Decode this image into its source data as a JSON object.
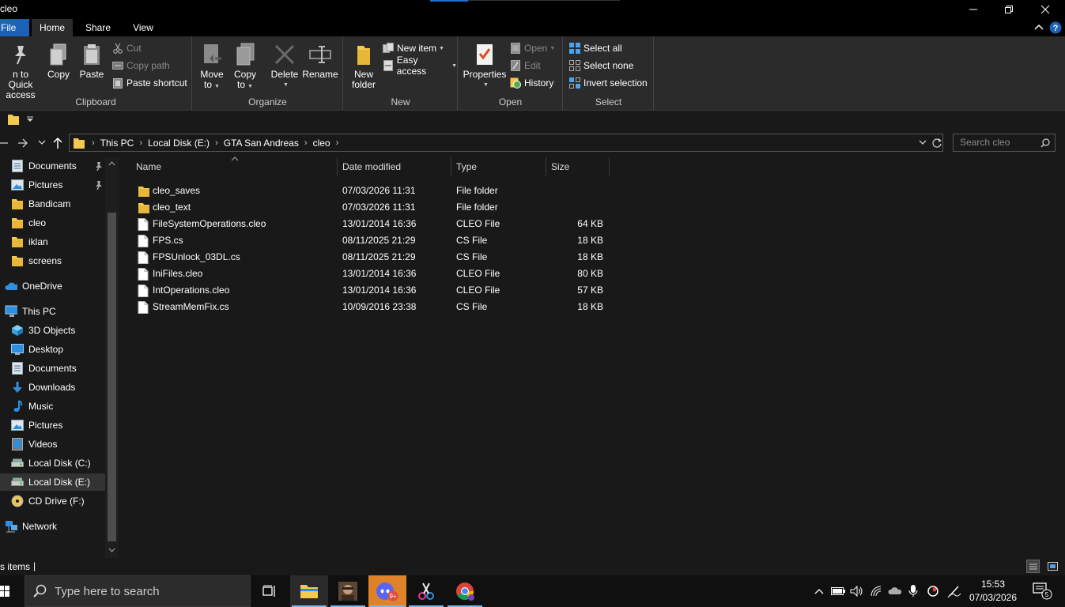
{
  "window": {
    "title": "cleo"
  },
  "ribbon_tabs": [
    "File",
    "Home",
    "Share",
    "View"
  ],
  "ribbon": {
    "clipboard": {
      "label": "Clipboard",
      "pin_label_1": "n to Quick",
      "pin_label_2": "access",
      "copy": "Copy",
      "paste": "Paste",
      "cut": "Cut",
      "copy_path": "Copy path",
      "paste_shortcut": "Paste shortcut"
    },
    "organize": {
      "label": "Organize",
      "move_to_1": "Move",
      "move_to_2": "to",
      "copy_to_1": "Copy",
      "copy_to_2": "to",
      "delete": "Delete",
      "rename": "Rename"
    },
    "new": {
      "label": "New",
      "new_folder_1": "New",
      "new_folder_2": "folder",
      "new_item": "New item",
      "easy_access": "Easy access"
    },
    "open": {
      "label": "Open",
      "properties": "Properties",
      "open": "Open",
      "edit": "Edit",
      "history": "History"
    },
    "select": {
      "label": "Select",
      "select_all": "Select all",
      "select_none": "Select none",
      "invert_selection": "Invert selection"
    }
  },
  "address": {
    "breadcrumbs": [
      "This PC",
      "Local Disk (E:)",
      "GTA San Andreas",
      "cleo"
    ],
    "search_placeholder": "Search cleo"
  },
  "nav": [
    {
      "label": "Documents",
      "icon": "documents-icon",
      "pinned": true
    },
    {
      "label": "Pictures",
      "icon": "pictures-icon",
      "pinned": true
    },
    {
      "label": "Bandicam",
      "icon": "folder-icon"
    },
    {
      "label": "cleo",
      "icon": "folder-icon"
    },
    {
      "label": "iklan",
      "icon": "folder-icon"
    },
    {
      "label": "screens",
      "icon": "folder-icon"
    },
    {
      "label": "OneDrive",
      "icon": "onedrive-icon"
    },
    {
      "label": "This PC",
      "icon": "this-pc-icon"
    },
    {
      "label": "3D Objects",
      "icon": "3d-objects-icon"
    },
    {
      "label": "Desktop",
      "icon": "desktop-icon"
    },
    {
      "label": "Documents",
      "icon": "documents-icon"
    },
    {
      "label": "Downloads",
      "icon": "downloads-icon"
    },
    {
      "label": "Music",
      "icon": "music-icon"
    },
    {
      "label": "Pictures",
      "icon": "pictures-icon"
    },
    {
      "label": "Videos",
      "icon": "videos-icon"
    },
    {
      "label": "Local Disk (C:)",
      "icon": "drive-icon"
    },
    {
      "label": "Local Disk (E:)",
      "icon": "drive-icon",
      "selected": true
    },
    {
      "label": "CD Drive (F:)",
      "icon": "cd-drive-icon"
    },
    {
      "label": "Network",
      "icon": "network-icon"
    }
  ],
  "columns": [
    "Name",
    "Date modified",
    "Type",
    "Size"
  ],
  "files": [
    {
      "name": "cleo_saves",
      "date": "07/03/2026 11:31",
      "type": "File folder",
      "size": "",
      "icon": "folder-icon"
    },
    {
      "name": "cleo_text",
      "date": "07/03/2026 11:31",
      "type": "File folder",
      "size": "",
      "icon": "folder-icon"
    },
    {
      "name": "FileSystemOperations.cleo",
      "date": "13/01/2014 16:36",
      "type": "CLEO File",
      "size": "64 KB",
      "icon": "file-icon"
    },
    {
      "name": "FPS.cs",
      "date": "08/11/2025 21:29",
      "type": "CS File",
      "size": "18 KB",
      "icon": "file-icon"
    },
    {
      "name": "FPSUnlock_03DL.cs",
      "date": "08/11/2025 21:29",
      "type": "CS File",
      "size": "18 KB",
      "icon": "file-icon"
    },
    {
      "name": "IniFiles.cleo",
      "date": "13/01/2014 16:36",
      "type": "CLEO File",
      "size": "80 KB",
      "icon": "file-icon"
    },
    {
      "name": "IntOperations.cleo",
      "date": "13/01/2014 16:36",
      "type": "CLEO File",
      "size": "57 KB",
      "icon": "file-icon"
    },
    {
      "name": "StreamMemFix.cs",
      "date": "10/09/2016 23:38",
      "type": "CS File",
      "size": "18 KB",
      "icon": "file-icon"
    }
  ],
  "status": {
    "items_text": "s items",
    "separator": "|"
  },
  "taskbar": {
    "search_placeholder": "Type here to search",
    "time": "15:53",
    "date": "07/03/2026",
    "notification_count": "5",
    "discord_badge": "9+"
  },
  "colors": {
    "accent": "#1b62b8",
    "background": "#191919",
    "ribbon": "#2b2b2b",
    "folder": "#f3c94e"
  }
}
